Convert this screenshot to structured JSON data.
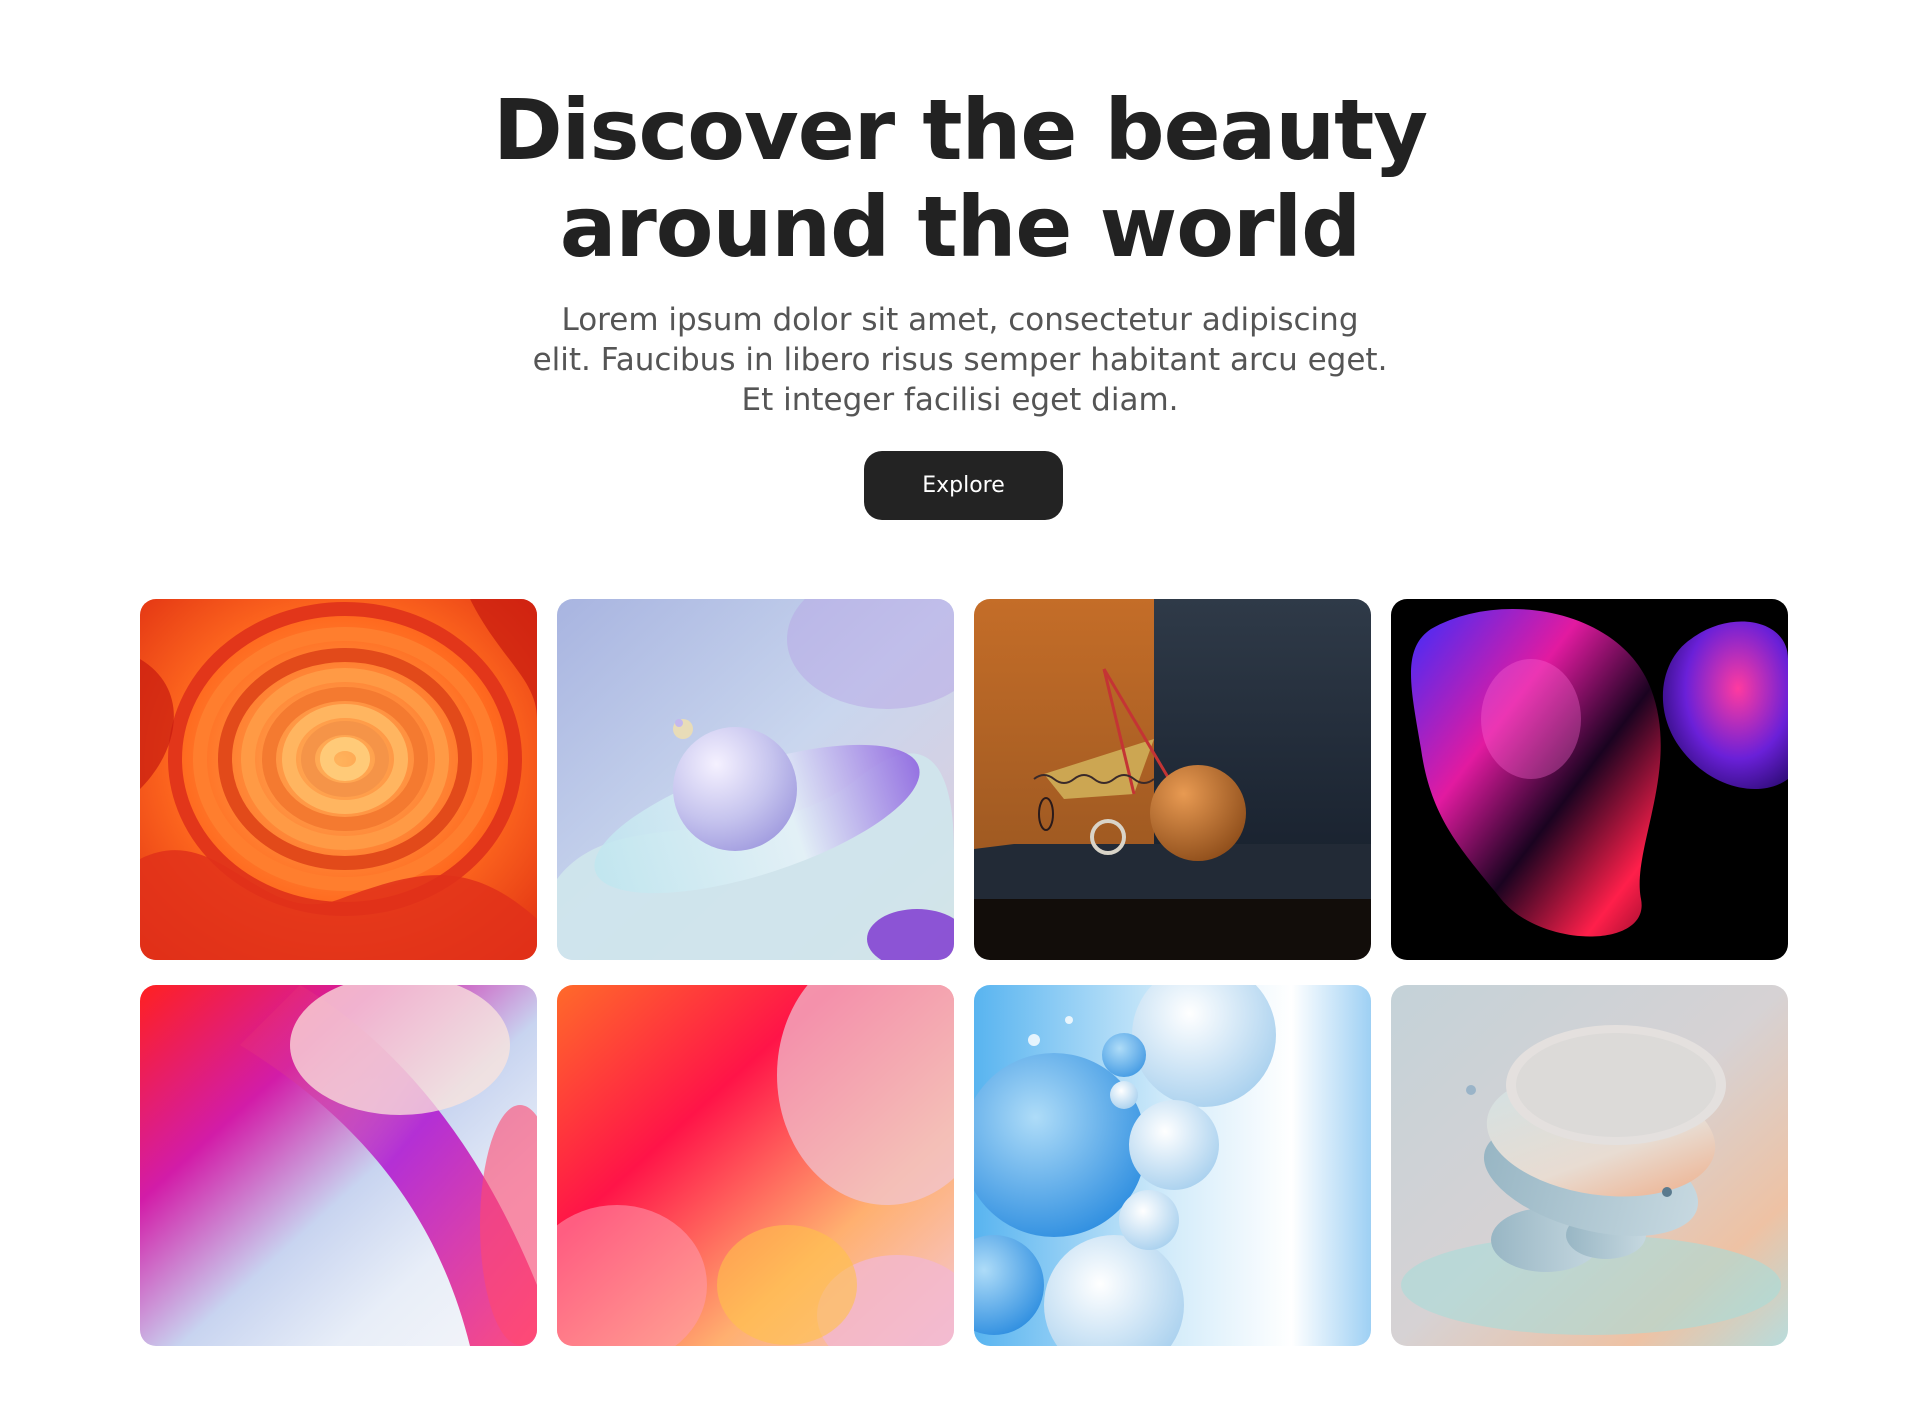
{
  "hero": {
    "headline_line1": "Discover the beauty",
    "headline_line2": "around the world",
    "subtext_line1": "Lorem ipsum dolor sit amet, consectetur adipiscing",
    "subtext_line2": "elit. Faucibus in libero risus semper habitant arcu eget.",
    "subtext_line3": "Et integer facilisi eget diam.",
    "button_label": "Explore"
  },
  "colors": {
    "heading": "#222222",
    "body_text": "#555555",
    "button_bg": "#232323",
    "button_text": "#ffffff",
    "page_bg": "#ffffff"
  }
}
